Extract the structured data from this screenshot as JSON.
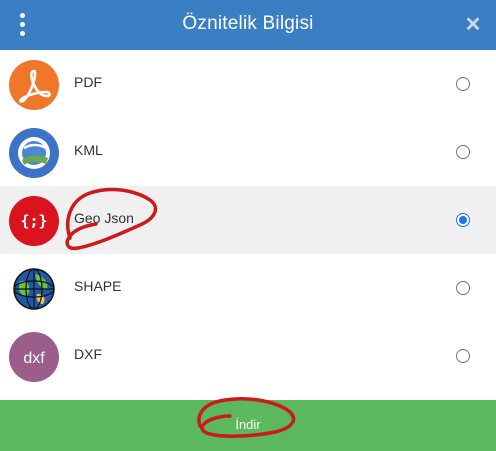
{
  "header": {
    "title": "Öznitelik Bilgisi",
    "menu_icon": "kebab-menu-icon",
    "close_icon": "close-icon",
    "background": "#3a7fc3"
  },
  "formats": [
    {
      "label": "PDF",
      "icon": "pdf-icon",
      "color": "#f0772a",
      "selected": false
    },
    {
      "label": "KML",
      "icon": "google-earth-icon",
      "color": "#3b73c6",
      "selected": false
    },
    {
      "label": "Geo Json",
      "icon": "geojson-icon",
      "color": "#d9141e",
      "selected": true
    },
    {
      "label": "SHAPE",
      "icon": "globe-icon",
      "color": "#2e8b57",
      "selected": false
    },
    {
      "label": "DXF",
      "icon": "dxf-icon",
      "color": "#9b5d8a",
      "selected": false
    }
  ],
  "dxf_icon_text": "dxf",
  "geojson_icon_text": "{;}",
  "footer": {
    "download_label": "İndir",
    "background": "#5cb85c"
  },
  "annotation_color": "#cc1a1a"
}
